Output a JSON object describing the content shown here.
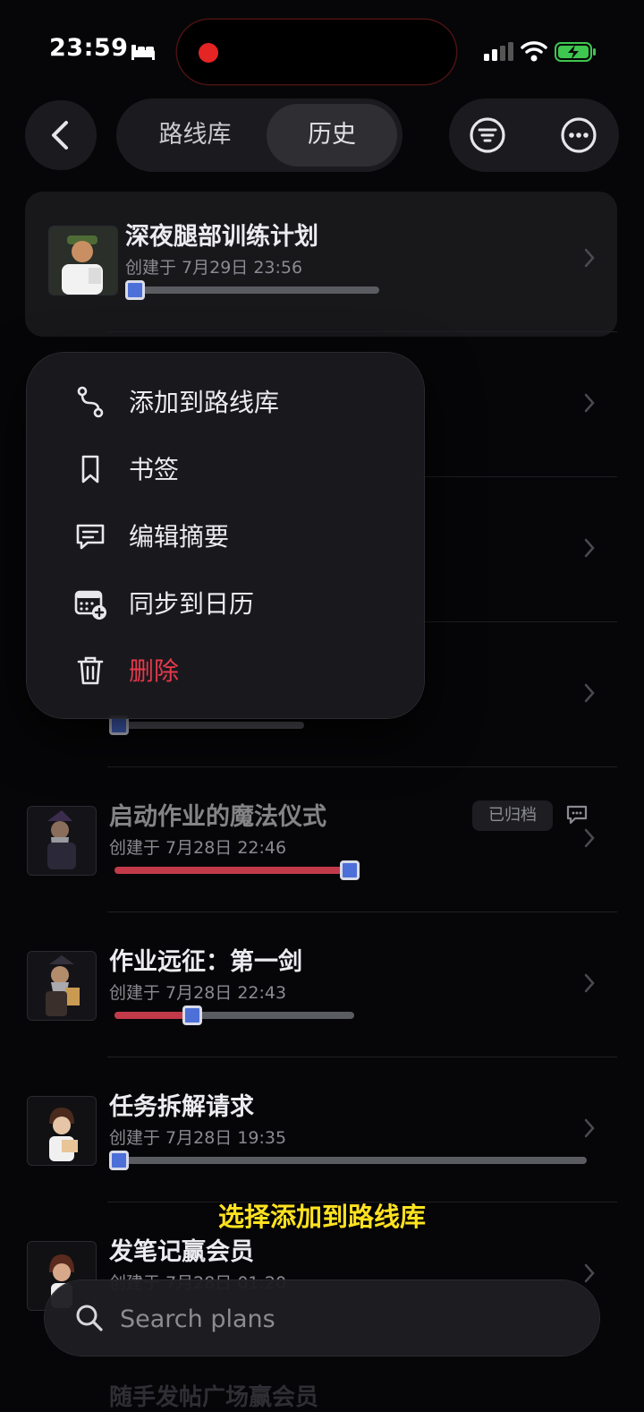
{
  "status_bar": {
    "time": "23:59"
  },
  "top_bar": {
    "tabs": [
      {
        "label": "路线库"
      },
      {
        "label": "历史"
      }
    ],
    "active_tab": "历史"
  },
  "plans": [
    {
      "title": "深夜腿部训练计划",
      "subtitle": "创建于 7月29日 23:56",
      "progress": 0.0
    },
    {
      "title": "启动作业的魔法仪式",
      "subtitle": "创建于 7月28日 22:46",
      "progress": 1.0,
      "badge": "已归档"
    },
    {
      "title": "作业远征：第一剑",
      "subtitle": "创建于 7月28日 22:43",
      "progress": 0.3
    },
    {
      "title": "任务拆解请求",
      "subtitle": "创建于 7月28日 19:35",
      "progress": 0.0
    },
    {
      "title": "发笔记赢会员",
      "subtitle": "创建于 7月28日 01:20",
      "progress": 0.0
    }
  ],
  "partial_next_title": "随手发帖广场赢会员",
  "context_menu": {
    "items": [
      {
        "label": "添加到路线库",
        "icon": "route-icon"
      },
      {
        "label": "书签",
        "icon": "bookmark-icon"
      },
      {
        "label": "编辑摘要",
        "icon": "comment-icon"
      },
      {
        "label": "同步到日历",
        "icon": "calendar-add-icon"
      },
      {
        "label": "删除",
        "icon": "trash-icon",
        "danger": true
      }
    ]
  },
  "caption": "选择添加到路线库",
  "search": {
    "placeholder": "Search plans",
    "value": ""
  },
  "colors": {
    "danger": "#e5384b",
    "progress_fill": "#c23a4a",
    "knob": "#4d6fd8",
    "caption": "#ffe21f"
  }
}
